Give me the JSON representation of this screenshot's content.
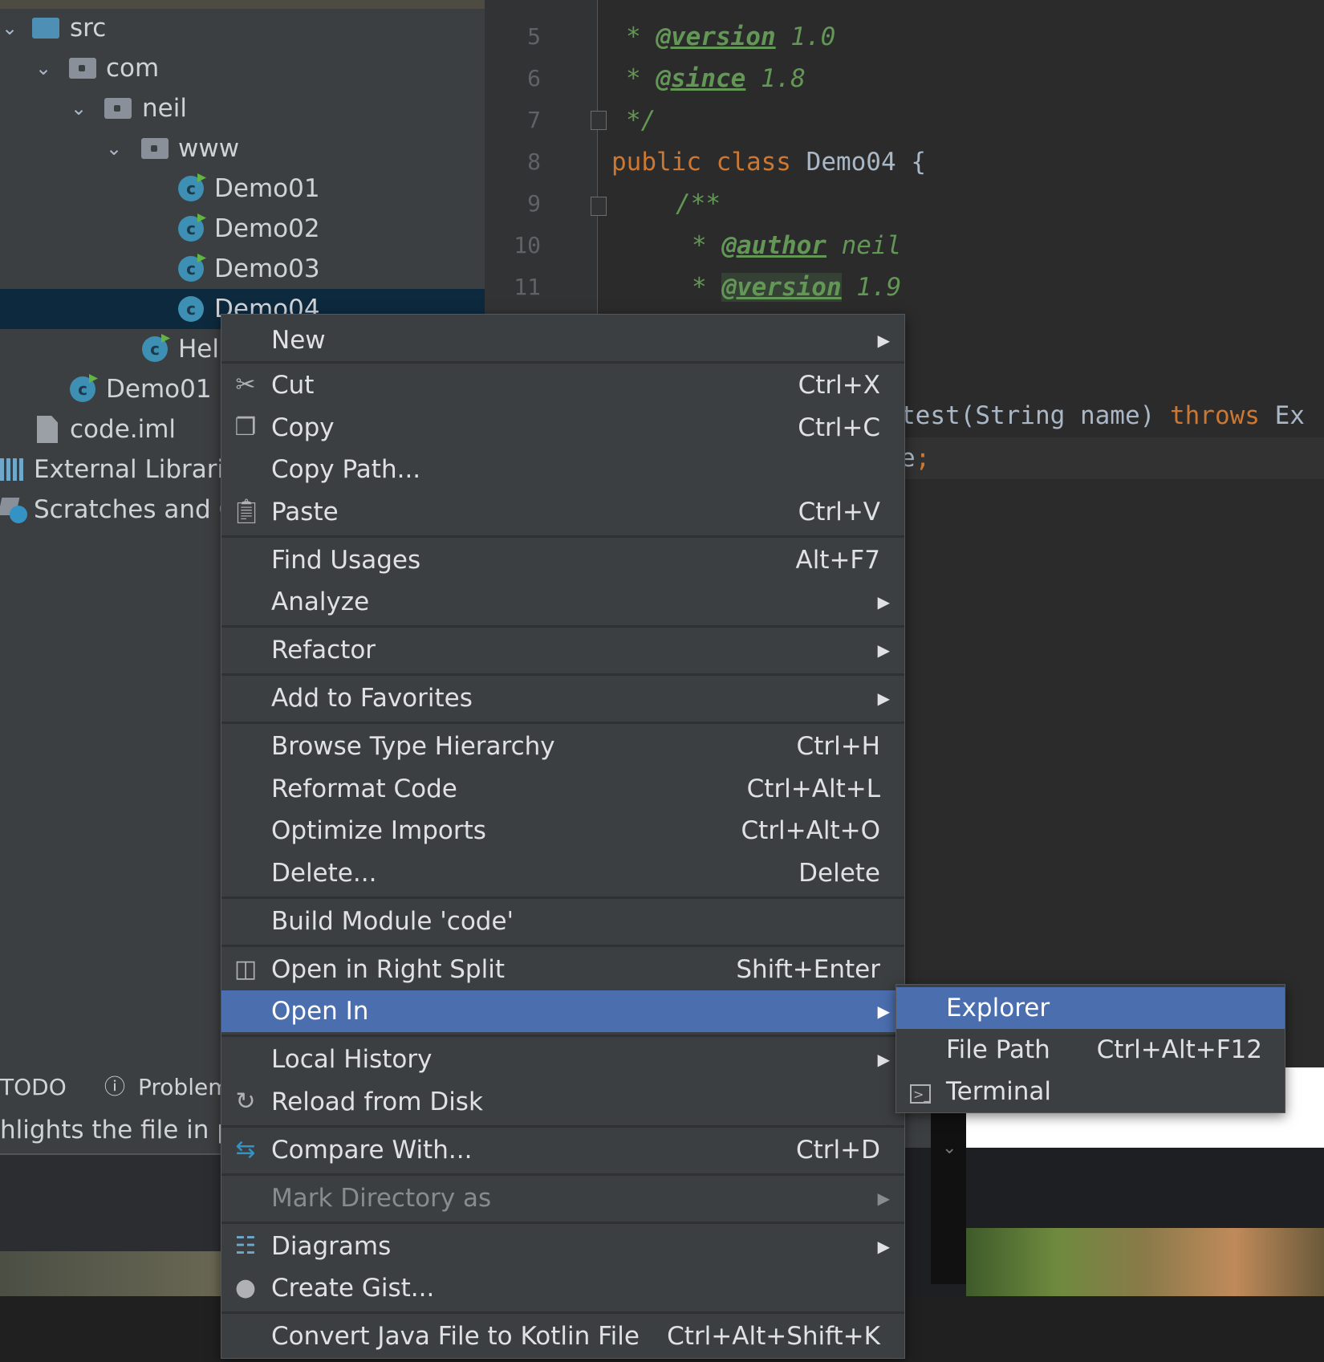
{
  "tree": {
    "items": [
      {
        "label": "src",
        "icon": "source-folder-icon",
        "chev": "⌄"
      },
      {
        "label": "com",
        "icon": "package-folder-icon",
        "chev": "⌄"
      },
      {
        "label": "neil",
        "icon": "package-folder-icon",
        "chev": "⌄"
      },
      {
        "label": "www",
        "icon": "package-folder-icon",
        "chev": "⌄"
      },
      {
        "label": "Demo01",
        "icon": "java-class-icon"
      },
      {
        "label": "Demo02",
        "icon": "java-class-icon"
      },
      {
        "label": "Demo03",
        "icon": "java-class-icon"
      },
      {
        "label": "Demo04",
        "icon": "java-class-icon"
      },
      {
        "label": "Hell",
        "icon": "java-class-icon"
      },
      {
        "label": "Demo01",
        "icon": "java-class-icon"
      },
      {
        "label": "code.iml",
        "icon": "iml-file-icon"
      },
      {
        "label": "External Librarie",
        "icon": "library-icon"
      },
      {
        "label": "Scratches and Co",
        "icon": "scratches-icon"
      }
    ]
  },
  "bottom": {
    "todo": "TODO",
    "problems": "Problem",
    "status": "hlights the file in pl"
  },
  "editor": {
    "lines": [
      {
        "n": "5",
        "star": "* ",
        "tag": "@version",
        "val": " 1.0"
      },
      {
        "n": "6",
        "star": "* ",
        "tag": "@since",
        "val": " 1.8"
      },
      {
        "n": "7",
        "text": "*/"
      },
      {
        "n": "8",
        "kw1": "public",
        "kw2": "class",
        "name": "Demo04",
        "brace": "{"
      },
      {
        "n": "9",
        "text": "/**"
      },
      {
        "n": "10",
        "star": "* ",
        "tag": "@author",
        "val": " neil"
      },
      {
        "n": "11",
        "star": "* ",
        "tag": "@version",
        "val": " 1.9"
      }
    ],
    "frag1_a": "test(String name) ",
    "frag1_kw": "throws",
    "frag1_b": " Ex",
    "frag2_a": "e",
    "frag2_b": ";"
  },
  "context_menu": {
    "items": [
      {
        "label": "New",
        "submenu": true
      },
      {
        "label": "Cut",
        "shortcut": "Ctrl+X",
        "icon": "scissors-icon"
      },
      {
        "label": "Copy",
        "shortcut": "Ctrl+C",
        "icon": "copy-icon"
      },
      {
        "label": "Copy Path...",
        "shortcut": ""
      },
      {
        "label": "Paste",
        "shortcut": "Ctrl+V",
        "icon": "clipboard-icon"
      },
      {
        "label": "Find Usages",
        "shortcut": "Alt+F7"
      },
      {
        "label": "Analyze",
        "submenu": true
      },
      {
        "label": "Refactor",
        "submenu": true
      },
      {
        "label": "Add to Favorites",
        "submenu": true
      },
      {
        "label": "Browse Type Hierarchy",
        "shortcut": "Ctrl+H"
      },
      {
        "label": "Reformat Code",
        "shortcut": "Ctrl+Alt+L"
      },
      {
        "label": "Optimize Imports",
        "shortcut": "Ctrl+Alt+O"
      },
      {
        "label": "Delete...",
        "shortcut": "Delete"
      },
      {
        "label": "Build Module 'code'",
        "shortcut": ""
      },
      {
        "label": "Open in Right Split",
        "shortcut": "Shift+Enter",
        "icon": "split-icon"
      },
      {
        "label": "Open In",
        "submenu": true,
        "highlighted": true
      },
      {
        "label": "Local History",
        "submenu": true
      },
      {
        "label": "Reload from Disk",
        "icon": "reload-icon"
      },
      {
        "label": "Compare With...",
        "shortcut": "Ctrl+D",
        "icon": "compare-icon"
      },
      {
        "label": "Mark Directory as",
        "submenu": true,
        "disabled": true
      },
      {
        "label": "Diagrams",
        "submenu": true,
        "icon": "diagrams-icon"
      },
      {
        "label": "Create Gist...",
        "icon": "github-icon"
      },
      {
        "label": "Convert Java File to Kotlin File",
        "shortcut": "Ctrl+Alt+Shift+K"
      }
    ]
  },
  "submenu": {
    "items": [
      {
        "label": "Explorer",
        "highlighted": true
      },
      {
        "label": "File Path",
        "shortcut": "Ctrl+Alt+F12"
      },
      {
        "label": "Terminal",
        "icon": "terminal-icon"
      }
    ]
  },
  "colors": {
    "menu_bg": "#3c3f41",
    "highlight": "#4b6eaf",
    "doc_comment": "#629755",
    "keyword": "#cc7832",
    "selection": "#0d293e"
  }
}
